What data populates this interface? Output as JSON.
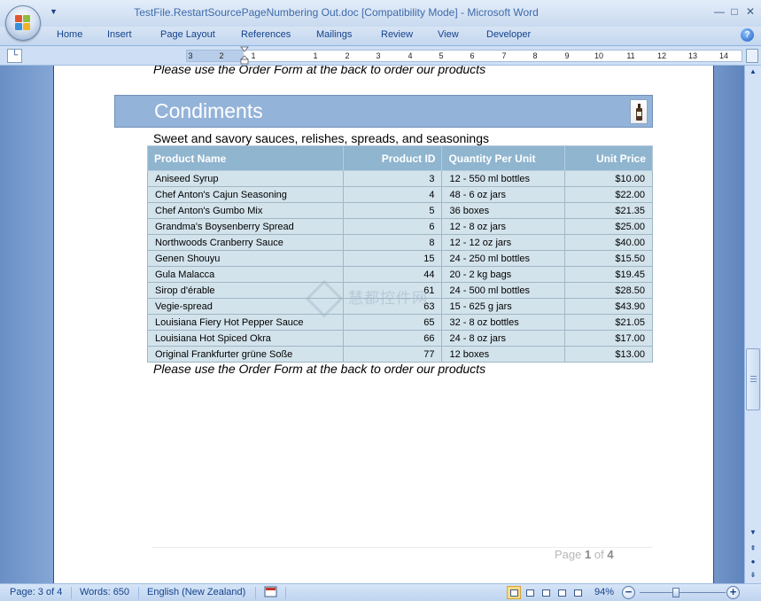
{
  "window": {
    "title": "TestFile.RestartSourcePageNumbering Out.doc [Compatibility Mode] - Microsoft Word",
    "minimize": "—",
    "maximize": "□",
    "close": "✕"
  },
  "ribbon": {
    "tabs": [
      "Home",
      "Insert",
      "Page Layout",
      "References",
      "Mailings",
      "Review",
      "View",
      "Developer"
    ],
    "help": "?"
  },
  "ruler": {
    "tab_selector": "└",
    "numbers": [
      "3",
      "2",
      "1",
      "1",
      "2",
      "3",
      "4",
      "5",
      "6",
      "7",
      "8",
      "9",
      "10",
      "11",
      "12",
      "13",
      "14"
    ]
  },
  "document": {
    "top_note": "Please use the Order Form at the back to order our products",
    "category": {
      "name": "Condiments",
      "description": "Sweet and savory sauces, relishes, spreads, and seasonings"
    },
    "table": {
      "headers": [
        "Product Name",
        "Product ID",
        "Quantity Per Unit",
        "Unit Price"
      ],
      "rows": [
        [
          "Aniseed Syrup",
          "3",
          "12 - 550 ml bottles",
          "$10.00"
        ],
        [
          "Chef Anton's Cajun Seasoning",
          "4",
          "48 - 6 oz jars",
          "$22.00"
        ],
        [
          "Chef Anton's Gumbo Mix",
          "5",
          "36 boxes",
          "$21.35"
        ],
        [
          "Grandma's Boysenberry Spread",
          "6",
          "12 - 8 oz jars",
          "$25.00"
        ],
        [
          "Northwoods Cranberry Sauce",
          "8",
          "12 - 12 oz jars",
          "$40.00"
        ],
        [
          "Genen Shouyu",
          "15",
          "24 - 250 ml bottles",
          "$15.50"
        ],
        [
          "Gula Malacca",
          "44",
          "20 - 2 kg bags",
          "$19.45"
        ],
        [
          "Sirop d'érable",
          "61",
          "24 - 500 ml bottles",
          "$28.50"
        ],
        [
          "Vegie-spread",
          "63",
          "15 - 625 g jars",
          "$43.90"
        ],
        [
          "Louisiana Fiery Hot Pepper Sauce",
          "65",
          "32 - 8 oz bottles",
          "$21.05"
        ],
        [
          "Louisiana Hot Spiced Okra",
          "66",
          "24 - 8 oz jars",
          "$17.00"
        ],
        [
          "Original Frankfurter grüne Soße",
          "77",
          "12 boxes",
          "$13.00"
        ]
      ]
    },
    "bottom_note": "Please use the Order Form at the back to order our products",
    "footer": {
      "page_word": "Page",
      "current": "1",
      "of_word": "of",
      "total": "4"
    },
    "watermark": "慧都控件网"
  },
  "statusbar": {
    "page": "Page: 3 of 4",
    "words": "Words: 650",
    "language": "English (New Zealand)",
    "zoom": "94%",
    "zoom_out": "−",
    "zoom_in": "+"
  },
  "icons": {
    "office": "office-logo-icon",
    "help": "help-icon",
    "scroll_up": "▲",
    "scroll_down": "▼",
    "prev_page": "⇞",
    "browse_object": "●",
    "next_page": "⇟"
  },
  "colors": {
    "category_band": "#94b3d9",
    "table_header": "#8fb5cf",
    "table_cell": "#d3e3ec",
    "ribbon_text": "#15428b"
  }
}
